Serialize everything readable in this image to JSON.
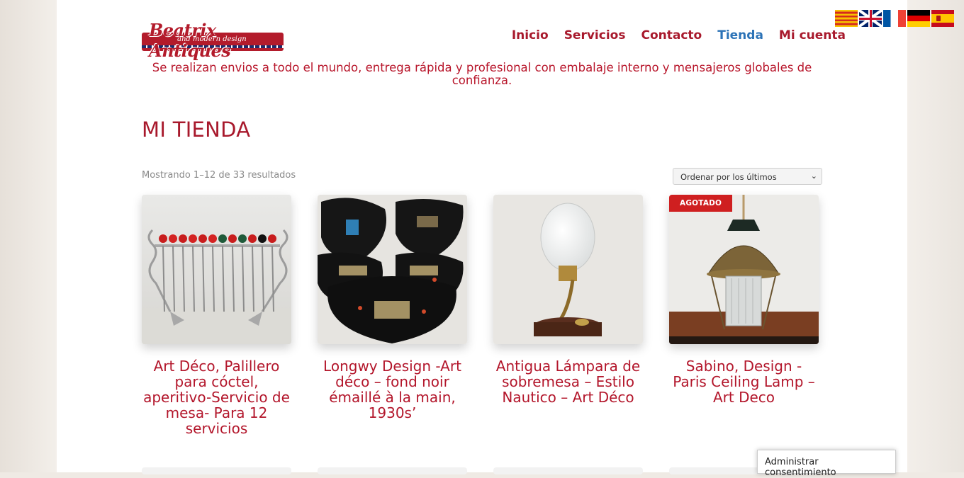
{
  "logo": {
    "title": "Beatrix Antiques",
    "subtitle": "and modern design"
  },
  "nav": [
    {
      "label": "Inicio",
      "active": false
    },
    {
      "label": "Servicios",
      "active": false
    },
    {
      "label": "Contacto",
      "active": false
    },
    {
      "label": "Tienda",
      "active": true
    },
    {
      "label": "Mi cuenta",
      "active": false
    }
  ],
  "flags": [
    "catalan-flag-icon",
    "uk-flag-icon",
    "france-flag-icon",
    "germany-flag-icon",
    "spain-flag-icon"
  ],
  "notice": "Se realizan envios a todo el mundo, entrega rápida y profesional con embalaje interno y mensajeros globales de confianza.",
  "page_title": "MI TIENDA",
  "result_count": "Mostrando 1–12 de 33 resultados",
  "sort": {
    "selected": "Ordenar por los últimos"
  },
  "products": [
    {
      "title": "Art Déco, Palillero para cóctel, aperitivo-Servicio de mesa- Para 12 servicios",
      "badge": ""
    },
    {
      "title": "Longwy Design -Art déco – fond noir émaillé à la main, 1930s’",
      "badge": ""
    },
    {
      "title": "Antigua Lámpara de sobremesa – Estilo Nautico – Art Déco",
      "badge": ""
    },
    {
      "title": "Sabino, Design - Paris Ceiling Lamp – Art Deco",
      "badge": "AGOTADO"
    }
  ],
  "consent_button": "Administrar consentimiento",
  "colors": {
    "brand": "#a8192c",
    "active_nav": "#2c73b7",
    "badge": "#cf1f20"
  }
}
